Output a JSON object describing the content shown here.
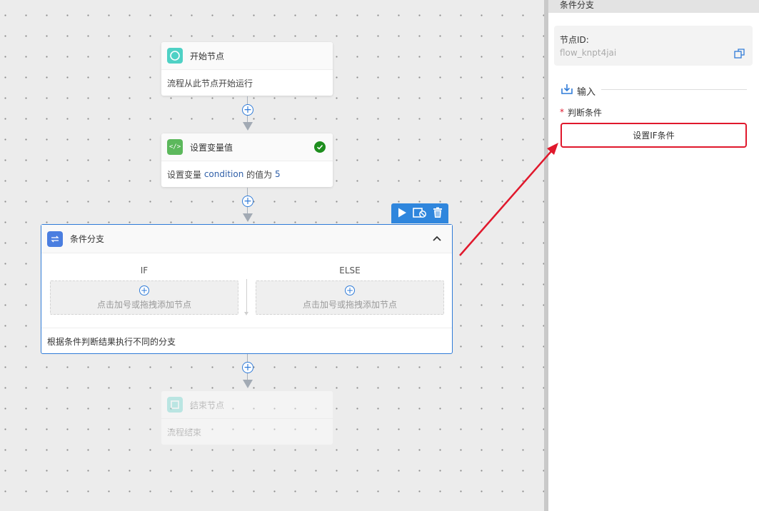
{
  "canvas": {
    "nodes": {
      "start": {
        "title": "开始节点",
        "desc": "流程从此节点开始运行"
      },
      "setvar": {
        "title": "设置变量值",
        "desc_prefix": "设置变量 ",
        "var_name": "condition",
        "desc_mid": " 的值为 ",
        "var_value": "5"
      },
      "condition": {
        "title": "条件分支",
        "branches": [
          {
            "label": "IF",
            "placeholder": "点击加号或拖拽添加节点"
          },
          {
            "label": "ELSE",
            "placeholder": "点击加号或拖拽添加节点"
          }
        ],
        "desc": "根据条件判断结果执行不同的分支"
      },
      "end": {
        "title": "结束节点",
        "desc": "流程结束"
      }
    }
  },
  "panel": {
    "title": "条件分支",
    "node_id_label": "节点ID:",
    "node_id_value": "flow_knpt4jai",
    "input_section": "输入",
    "required_mark": "*",
    "condition_label": "判断条件",
    "set_if_button": "设置IF条件"
  },
  "colors": {
    "accent": "#2f7bd8",
    "annotation": "#e0182c",
    "start_icon": "#4fd1c5",
    "setvar_icon": "#5cb85c",
    "condition_icon": "#4a7ee0",
    "check": "#1e8e1e"
  }
}
